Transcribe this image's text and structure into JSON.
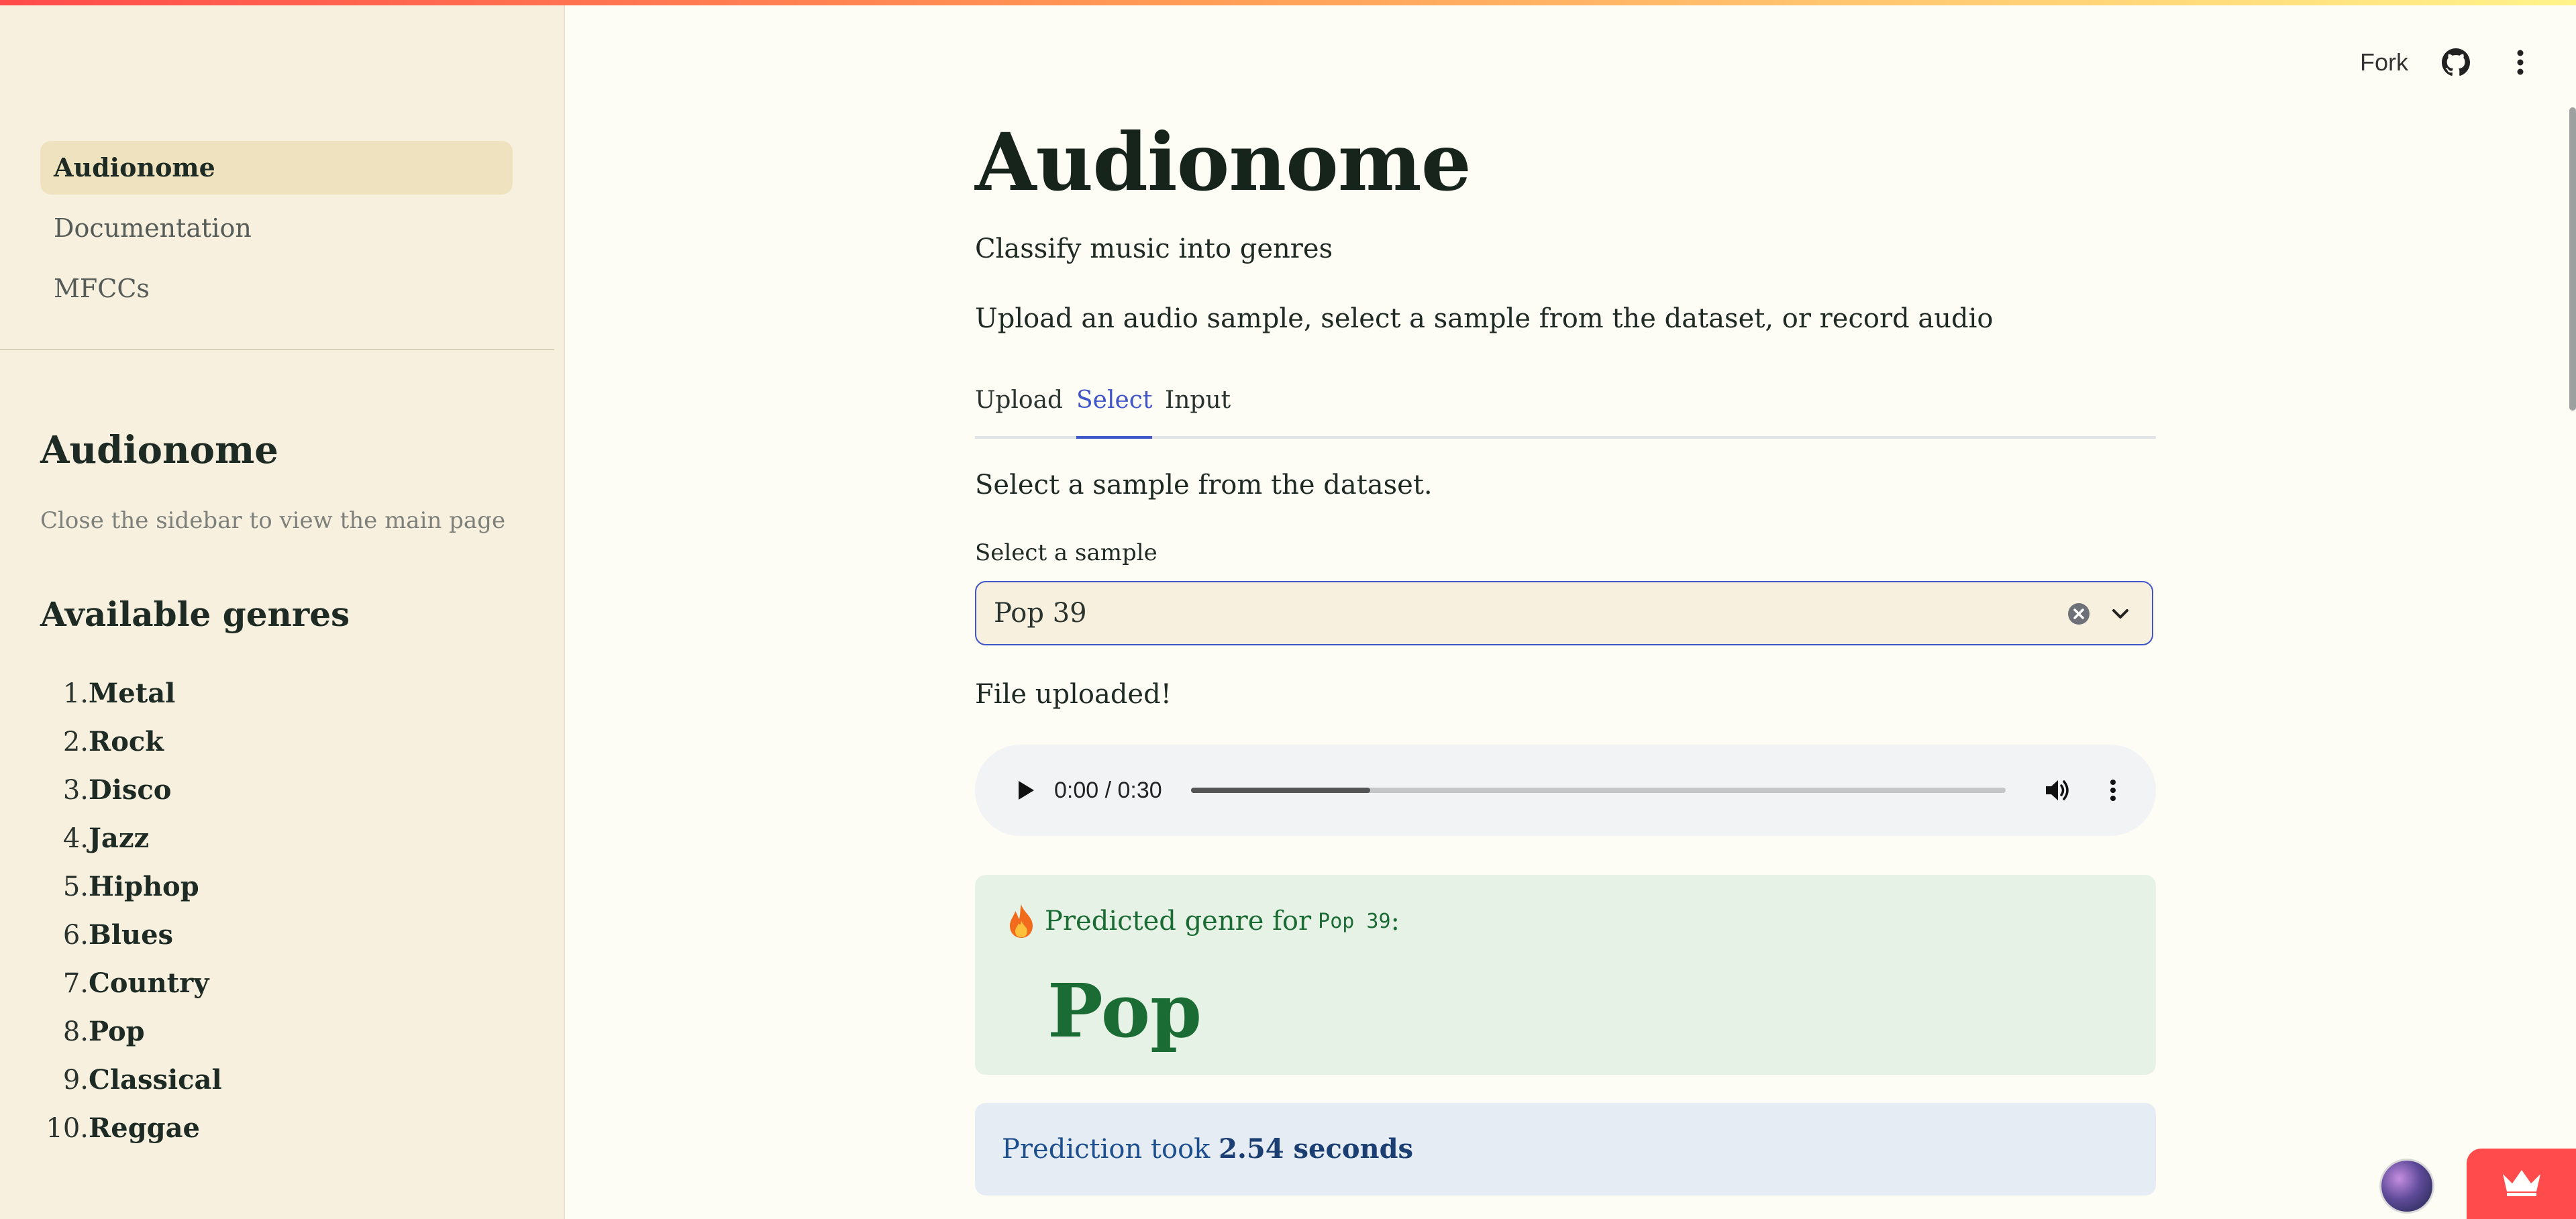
{
  "header": {
    "fork_label": "Fork",
    "icons": [
      "github-icon",
      "kebab-menu-icon"
    ]
  },
  "sidebar": {
    "nav": [
      {
        "label": "Audionome",
        "active": true
      },
      {
        "label": "Documentation",
        "active": false
      },
      {
        "label": "MFCCs",
        "active": false
      }
    ],
    "title": "Audionome",
    "caption": "Close the sidebar to view the main page",
    "genres_title": "Available genres",
    "genres": [
      {
        "num": "1.",
        "name": "Metal"
      },
      {
        "num": "2.",
        "name": "Rock"
      },
      {
        "num": "3.",
        "name": "Disco"
      },
      {
        "num": "4.",
        "name": "Jazz"
      },
      {
        "num": "5.",
        "name": "Hiphop"
      },
      {
        "num": "6.",
        "name": "Blues"
      },
      {
        "num": "7.",
        "name": "Country"
      },
      {
        "num": "8.",
        "name": "Pop"
      },
      {
        "num": "9.",
        "name": "Classical"
      },
      {
        "num": "10.",
        "name": "Reggae"
      }
    ]
  },
  "main": {
    "title": "Audionome",
    "subtitle": "Classify music into genres",
    "instructions": "Upload an audio sample, select a sample from the dataset, or record audio",
    "tabs": [
      {
        "label": "Upload",
        "active": false
      },
      {
        "label": "Select",
        "active": true
      },
      {
        "label": "Input",
        "active": false
      }
    ],
    "select_description": "Select a sample from the dataset.",
    "select_label": "Select a sample",
    "select_value": "Pop 39",
    "uploaded_message": "File uploaded!",
    "audio": {
      "time": "0:00 / 0:30",
      "buffered_fraction": 0.22
    },
    "result": {
      "prefix": "Predicted genre for",
      "sample": "Pop 39",
      "suffix": ":",
      "genre": "Pop"
    },
    "timing": {
      "prefix": "Prediction took",
      "value": "2.54 seconds"
    }
  },
  "colors": {
    "accent": "#4055c8",
    "success_bg": "#e6f2e5",
    "success_text": "#1a6b34",
    "info_bg": "#e5ecf4",
    "sidebar_bg": "#f7f0de",
    "brand_red": "#ff4b4b"
  }
}
